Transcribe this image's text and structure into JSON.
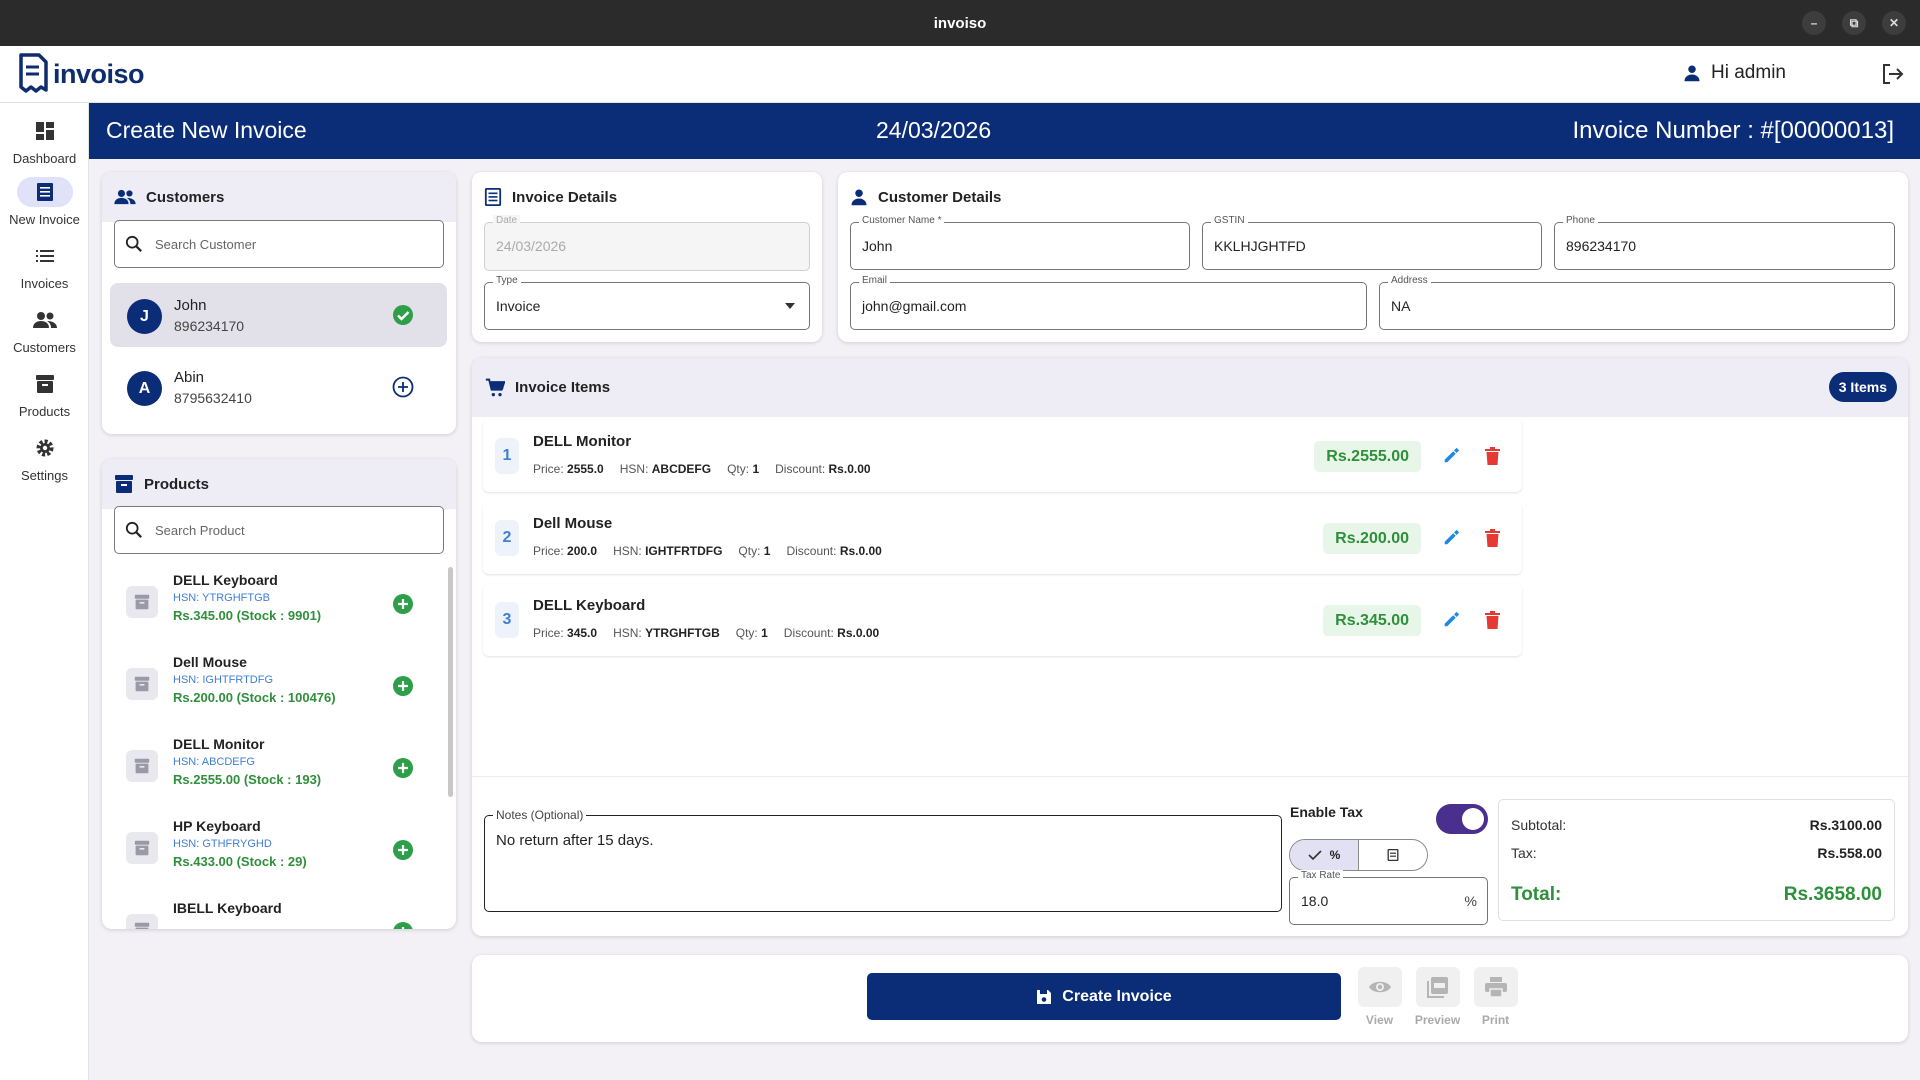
{
  "window": {
    "title": "invoiso",
    "controls": [
      "–",
      "⧉",
      "✕"
    ]
  },
  "app": {
    "name": "invoiso",
    "greeting": "Hi admin"
  },
  "sidebar": {
    "items": [
      {
        "label": "Dashboard",
        "icon": "dashboard-icon"
      },
      {
        "label": "New Invoice",
        "icon": "receipt-icon",
        "active": true
      },
      {
        "label": "Invoices",
        "icon": "list-icon"
      },
      {
        "label": "Customers",
        "icon": "people-icon"
      },
      {
        "label": "Products",
        "icon": "inventory-icon"
      },
      {
        "label": "Settings",
        "icon": "gear-icon"
      }
    ]
  },
  "header": {
    "title": "Create New Invoice",
    "date": "24/03/2026",
    "invoice_number": "Invoice Number : #[00000013]"
  },
  "customers_panel": {
    "title": "Customers",
    "search_placeholder": "Search Customer",
    "items": [
      {
        "initial": "J",
        "name": "John",
        "phone": "896234170",
        "selected": true
      },
      {
        "initial": "A",
        "name": "Abin",
        "phone": "8795632410",
        "selected": false
      }
    ]
  },
  "products_panel": {
    "title": "Products",
    "search_placeholder": "Search Product",
    "items": [
      {
        "name": "DELL Keyboard",
        "hsn": "HSN: YTRGHFTGB",
        "price": "Rs.345.00  (Stock : 9901)"
      },
      {
        "name": "Dell Mouse",
        "hsn": "HSN: IGHTFRTDFG",
        "price": "Rs.200.00  (Stock : 100476)"
      },
      {
        "name": "DELL Monitor",
        "hsn": "HSN: ABCDEFG",
        "price": "Rs.2555.00  (Stock : 193)"
      },
      {
        "name": "HP Keyboard",
        "hsn": "HSN: GTHFRYGHD",
        "price": "Rs.433.00  (Stock : 29)"
      },
      {
        "name": "IBELL Keyboard",
        "hsn": "",
        "price": ""
      }
    ]
  },
  "invoice_details": {
    "title": "Invoice Details",
    "date_label": "Date",
    "date_value": "24/03/2026",
    "type_label": "Type",
    "type_value": "Invoice"
  },
  "customer_details": {
    "title": "Customer Details",
    "name_label": "Customer Name *",
    "name_value": "John",
    "gstin_label": "GSTIN",
    "gstin_value": "KKLHJGHTFD",
    "phone_label": "Phone",
    "phone_value": "896234170",
    "email_label": "Email",
    "email_value": "john@gmail.com",
    "address_label": "Address",
    "address_value": "NA"
  },
  "invoice_items": {
    "title": "Invoice Items",
    "count_badge": "3 Items",
    "price_label": "Price:",
    "hsn_label": "HSN:",
    "qty_label": "Qty:",
    "discount_label": "Discount:",
    "items": [
      {
        "num": "1",
        "name": "DELL Monitor",
        "price": "2555.0",
        "hsn": "ABCDEFG",
        "qty": "1",
        "discount": "Rs.0.00",
        "total": "Rs.2555.00"
      },
      {
        "num": "2",
        "name": "Dell Mouse",
        "price": "200.0",
        "hsn": "IGHTFRTDFG",
        "qty": "1",
        "discount": "Rs.0.00",
        "total": "Rs.200.00"
      },
      {
        "num": "3",
        "name": "DELL Keyboard",
        "price": "345.0",
        "hsn": "YTRGHFTGB",
        "qty": "1",
        "discount": "Rs.0.00",
        "total": "Rs.345.00"
      }
    ]
  },
  "footer_form": {
    "notes_label": "Notes (Optional)",
    "notes_value": "No return after 15 days.",
    "enable_tax_label": "Enable Tax",
    "enable_tax_on": true,
    "tax_mode_percent": "%",
    "tax_rate_label": "Tax Rate",
    "tax_rate_value": "18.0",
    "tax_rate_suffix": "%"
  },
  "totals": {
    "subtotal_label": "Subtotal:",
    "subtotal": "Rs.3100.00",
    "tax_label": "Tax:",
    "tax": "Rs.558.00",
    "total_label": "Total:",
    "total": "Rs.3658.00"
  },
  "actions": {
    "create": "Create Invoice",
    "view": "View",
    "preview": "Preview",
    "print": "Print"
  },
  "colors": {
    "primary": "#0b2d78",
    "green": "#2f8f3a",
    "red": "#e53935",
    "blue": "#3f7fd8",
    "toggle": "#4a2f8f"
  }
}
